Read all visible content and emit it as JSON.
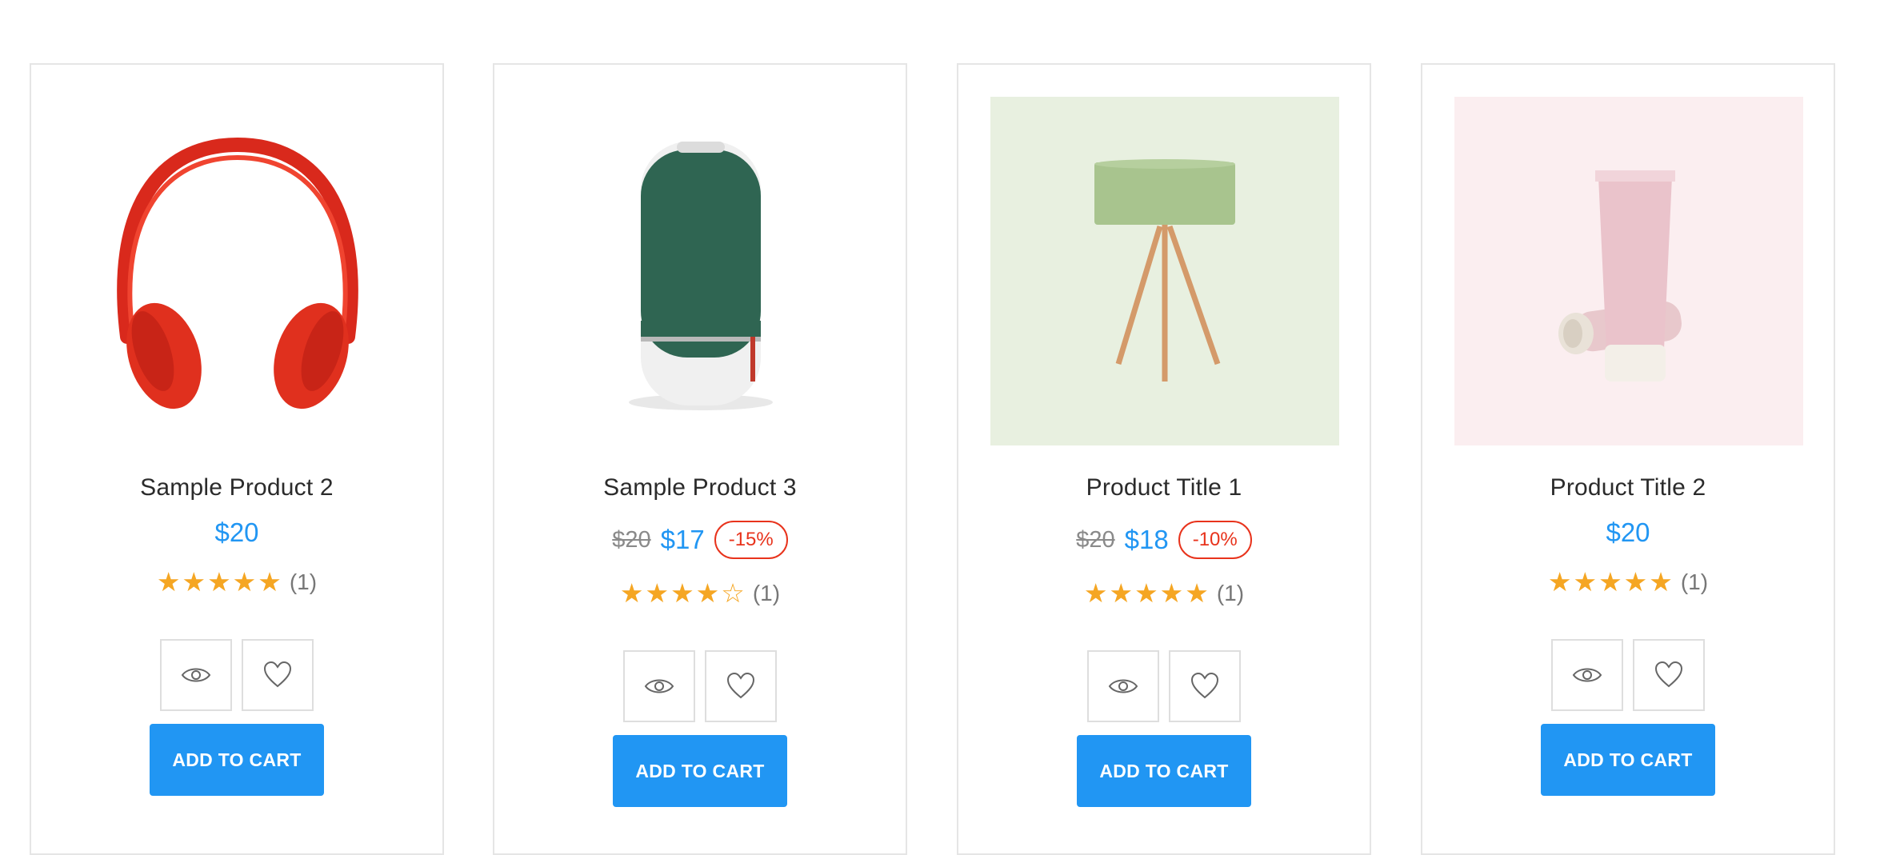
{
  "products": [
    {
      "title": "Sample Product 2",
      "price": "$20",
      "old_price": "",
      "discount": "",
      "rating": 5,
      "rating_count": "(1)",
      "add_to_cart_label": "ADD TO CART",
      "image_icon": "headphones-image"
    },
    {
      "title": "Sample Product 3",
      "price": "$17",
      "old_price": "$20",
      "discount": "-15%",
      "rating": 4,
      "rating_count": "(1)",
      "add_to_cart_label": "ADD TO CART",
      "image_icon": "speaker-image"
    },
    {
      "title": "Product Title 1",
      "price": "$18",
      "old_price": "$20",
      "discount": "-10%",
      "rating": 5,
      "rating_count": "(1)",
      "add_to_cart_label": "ADD TO CART",
      "image_icon": "lamp-image"
    },
    {
      "title": "Product Title 2",
      "price": "$20",
      "old_price": "",
      "discount": "",
      "rating": 5,
      "rating_count": "(1)",
      "add_to_cart_label": "ADD TO CART",
      "image_icon": "cosmetic-tube-image"
    }
  ],
  "colors": {
    "accent": "#2196f3",
    "star": "#f5a623",
    "discount": "#e8331c"
  }
}
